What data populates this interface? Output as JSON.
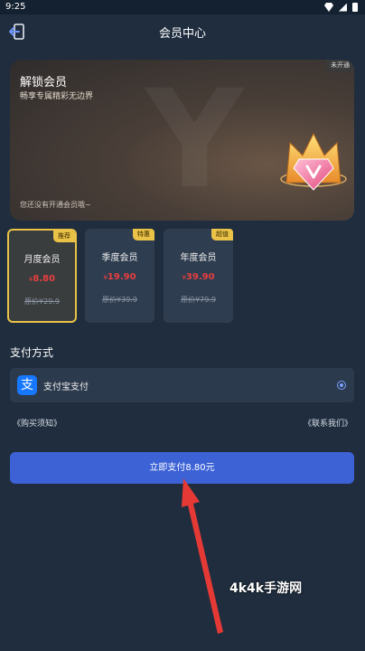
{
  "status": {
    "time": "9:25"
  },
  "header": {
    "title": "会员中心"
  },
  "banner": {
    "title": "解锁会员",
    "subtitle": "畅享专属精彩无边界",
    "tag": "未开通",
    "note": "您还没有开通会员哦~"
  },
  "plans": [
    {
      "badge": "推荐",
      "name": "月度会员",
      "currency": "¥",
      "price": "8.80",
      "original": "原价¥29.9",
      "selected": true
    },
    {
      "badge": "特惠",
      "name": "季度会员",
      "currency": "¥",
      "price": "19.90",
      "original": "原价¥39.9",
      "selected": false
    },
    {
      "badge": "超值",
      "name": "年度会员",
      "currency": "¥",
      "price": "39.90",
      "original": "原价¥79.9",
      "selected": false
    }
  ],
  "payment": {
    "section_label": "支付方式",
    "method_label": "支付宝支付",
    "method_icon": "支"
  },
  "links": {
    "notice": "《购买须知》",
    "contact": "《联系我们》"
  },
  "pay_button": {
    "label": "立即支付8.80元"
  },
  "watermark": "4k4k手游网",
  "colors": {
    "accent": "#3c62d6",
    "price_red": "#e83e3e",
    "badge_gold": "#e9c247",
    "alipay_blue": "#1677ff",
    "arrow_red": "#e53935"
  }
}
